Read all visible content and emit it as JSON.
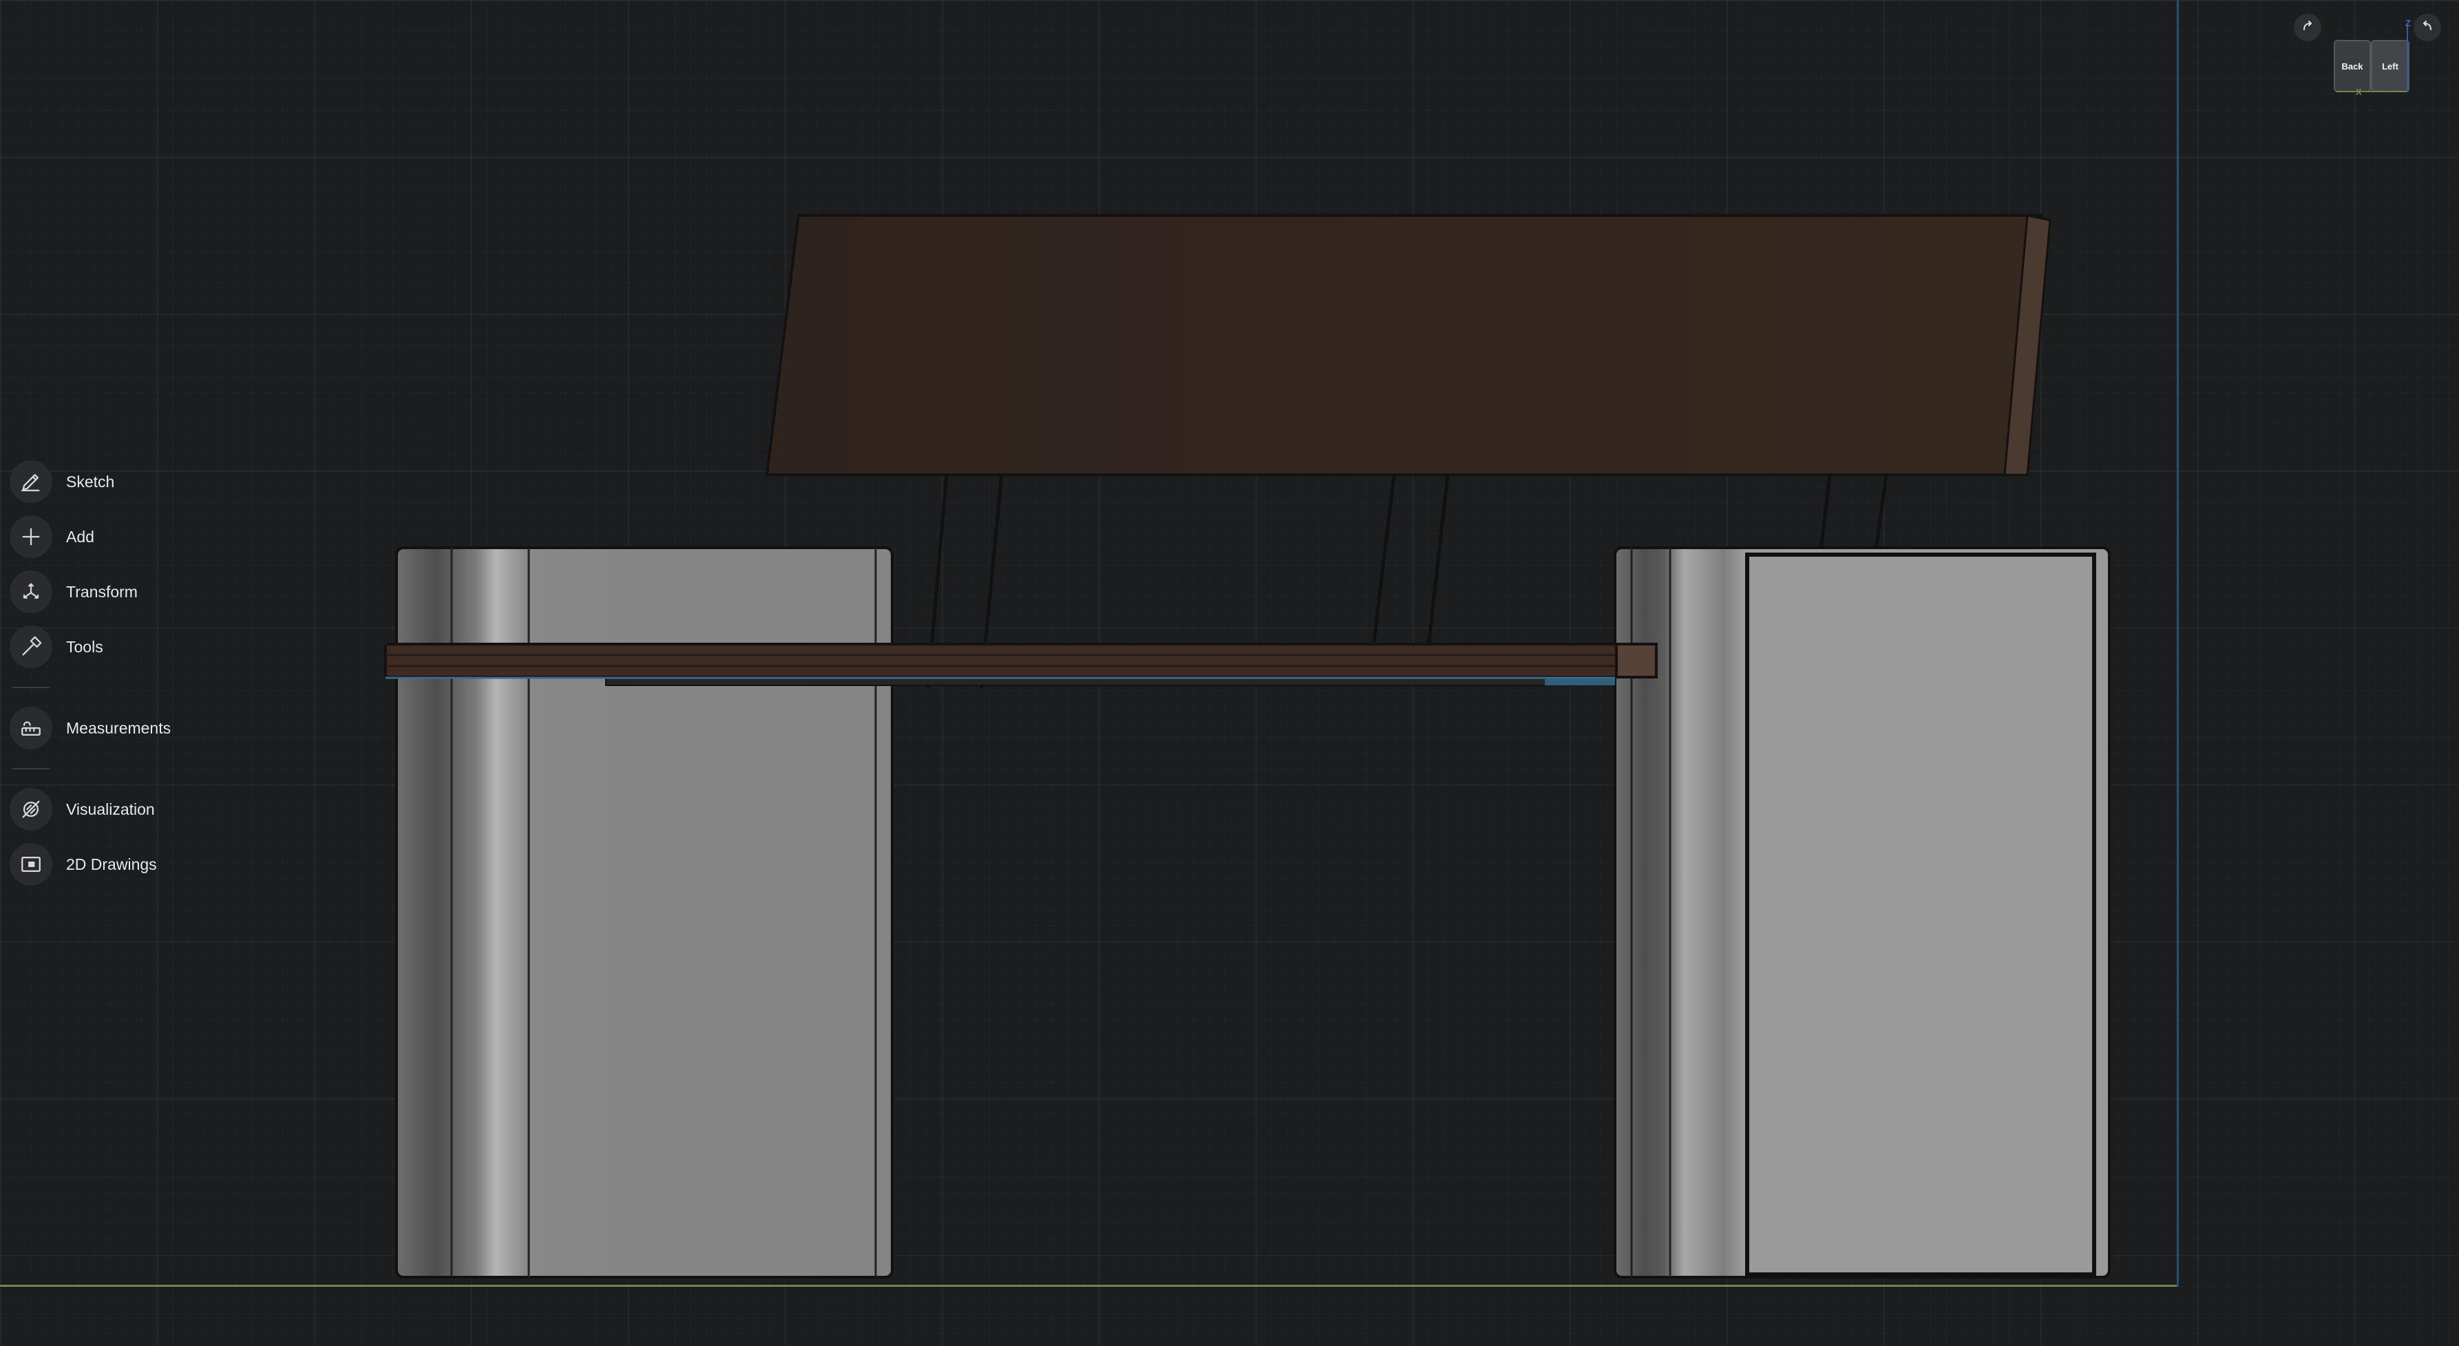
{
  "toolbar": {
    "sketch": "Sketch",
    "add": "Add",
    "transform": "Transform",
    "tools": "Tools",
    "measurements": "Measurements",
    "visualization": "Visualization",
    "drawings": "2D Drawings"
  },
  "viewcube": {
    "back_face": "Back",
    "left_face": "Left",
    "z_axis": "Z",
    "x_axis": "X",
    "rotate_cw_icon": "rotate-clockwise-icon",
    "rotate_ccw_icon": "rotate-counterclockwise-icon"
  },
  "colors": {
    "background": "#1c1d1e",
    "backrest": "#33261f",
    "seat": "#3d2a22",
    "legs": "#8f8f8f",
    "ground_axis": "#6b8a4a",
    "vertical_axis": "#2f4c78"
  }
}
